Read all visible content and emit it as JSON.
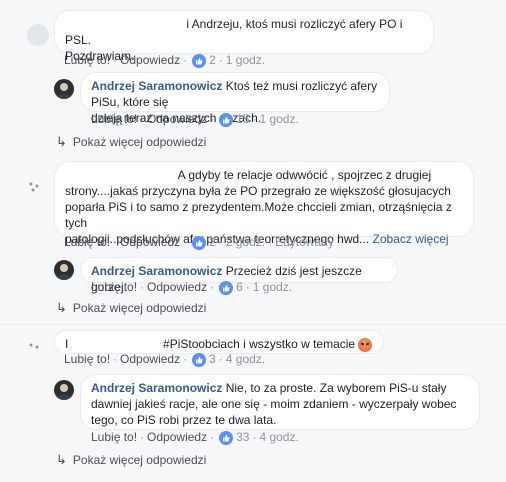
{
  "comments": [
    {
      "text_suffix": "i Andrzeju, ktoś musi rozliczyć afery PO i PSL.",
      "text_line2": "Pozdrawiam.",
      "actions": {
        "like": "Lubię to!",
        "reply": "Odpowiedz",
        "likes": "2",
        "time": "1 godz."
      },
      "reply": {
        "author": "Andrzej Saramonowicz",
        "text1": "Ktoś też musi rozliczyć afery PiSu, które się",
        "text2": "dzieją teraz na naszych oczach.",
        "actions": {
          "like": "Lubię to!",
          "reply": "Odpowiedz",
          "likes": "15",
          "time": "1 godz."
        }
      },
      "more": "Pokaż więcej odpowiedzi"
    },
    {
      "text1_suffix": "A gdyby te relacje odwwócić , spojrzec z drugiej",
      "text2": "strony....jakaś przyczyna była że PO przegrało ze większość głosujacych",
      "text3": "poparła PiS i to samo z prezydentem.Może chccieli zmian, otrząśnięcia z tych",
      "text4": "patologii..podsłuchów afer.państwa teorretycznego hwd...",
      "see_more": "Zobacz więcej",
      "actions": {
        "like": "Lubię to!",
        "reply": "Odpowiedz",
        "likes": "2",
        "time": "2 godz.",
        "edited": "Edytowany"
      },
      "reply": {
        "author": "Andrzej Saramonowicz",
        "text1": "Przecież dziś jest jeszcze gorzej.",
        "actions": {
          "like": "Lubię to!",
          "reply": "Odpowiedz",
          "likes": "6",
          "time": "1 godz."
        }
      },
      "more": "Pokaż więcej odpowiedzi"
    },
    {
      "prefix": "I",
      "text1_suffix": "#PiStoobciach i wszystko w temacie",
      "actions": {
        "like": "Lubię to!",
        "reply": "Odpowiedz",
        "likes": "3",
        "time": "4 godz."
      },
      "reply": {
        "author": "Andrzej Saramonowicz",
        "text1": "Nie, to za proste. Za wyborem PiS-u stały",
        "text2": "dawniej jakieś racje, ale one się - moim zdaniem - wyczerpały wobec",
        "text3": "tego, co PiS robi przez te dwa lata.",
        "actions": {
          "like": "Lubię to!",
          "reply": "Odpowiedz",
          "likes": "33",
          "time": "4 godz."
        }
      },
      "more": "Pokaż więcej odpowiedzi"
    }
  ],
  "colors": {
    "link": "#365899",
    "like": "#5890ff",
    "meta": "#90949c"
  },
  "icons": {
    "like": "thumbs-up-icon",
    "reply_arrow": "reply-arrow-icon",
    "angry": "angry-face-emoji"
  }
}
